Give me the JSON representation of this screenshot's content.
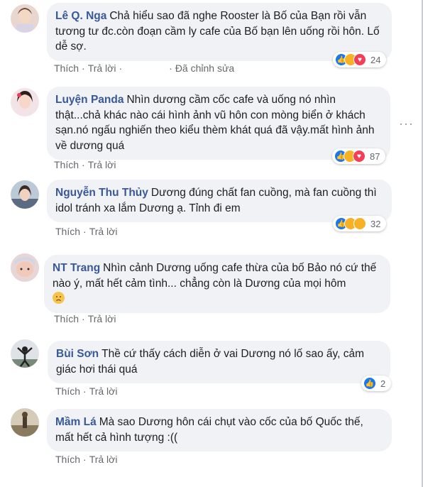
{
  "actions": {
    "like": "Thích",
    "reply": "Trả lời",
    "separator": "·"
  },
  "colors": {
    "author": "#385898",
    "bubble": "#f0f2f5",
    "meta": "#65676b",
    "like": "#1877f2",
    "haha": "#f7b125",
    "love": "#f33e58"
  },
  "comments": [
    {
      "author": "Lê Q. Nga",
      "text": "Chả hiểu sao đã nghe Rooster là Bố của Bạn rồi vẫn tương tư đc.còn đoạn cầm ly cafe của Bố bạn lên uống rồi hôn. Lố dễ sợ.",
      "edited": "Đã chỉnh sửa",
      "reactions": [
        "like",
        "haha",
        "love"
      ],
      "reaction_count": "24"
    },
    {
      "author": "Luyện Panda",
      "text": "Nhìn dương cầm cốc cafe và uống nó nhìn thật...chả khác nào cái hình ảnh vũ hôn con mòng biển ở khách sạn.nó ngấu nghiến theo kiểu thèm khát quá đã vậy.mất hình ảnh về dương quá",
      "reactions": [
        "like",
        "haha",
        "love"
      ],
      "reaction_count": "87"
    },
    {
      "author": "Nguyễn Thu Thủy",
      "text": "Dương đúng chất fan cuồng, mà fan cuồng thì idol tránh xa lắm Dương ạ. Tỉnh đi em",
      "reactions": [
        "like",
        "haha",
        "sad"
      ],
      "reaction_count": "32"
    },
    {
      "author": "NT Trang",
      "text": "Nhìn cảnh Dương uống cafe thừa của bố Bảo nó cứ thế nào ý, mất hết cảm tình... chẳng còn là Dương của mọi hôm",
      "emoji": "worried-emoji"
    },
    {
      "author": "Bùi Sơn",
      "text": "Thề cứ thấy cách diễn ở vai Dương nó lố sao ấy, cảm giác hơi thái quá",
      "reactions": [
        "like"
      ],
      "reaction_count": "2"
    },
    {
      "author": "Mầm Lá",
      "text": "Mà sao Dương hôn cái chụt vào cốc của bố Quốc thế, mất hết cả hình tượng :(("
    }
  ]
}
